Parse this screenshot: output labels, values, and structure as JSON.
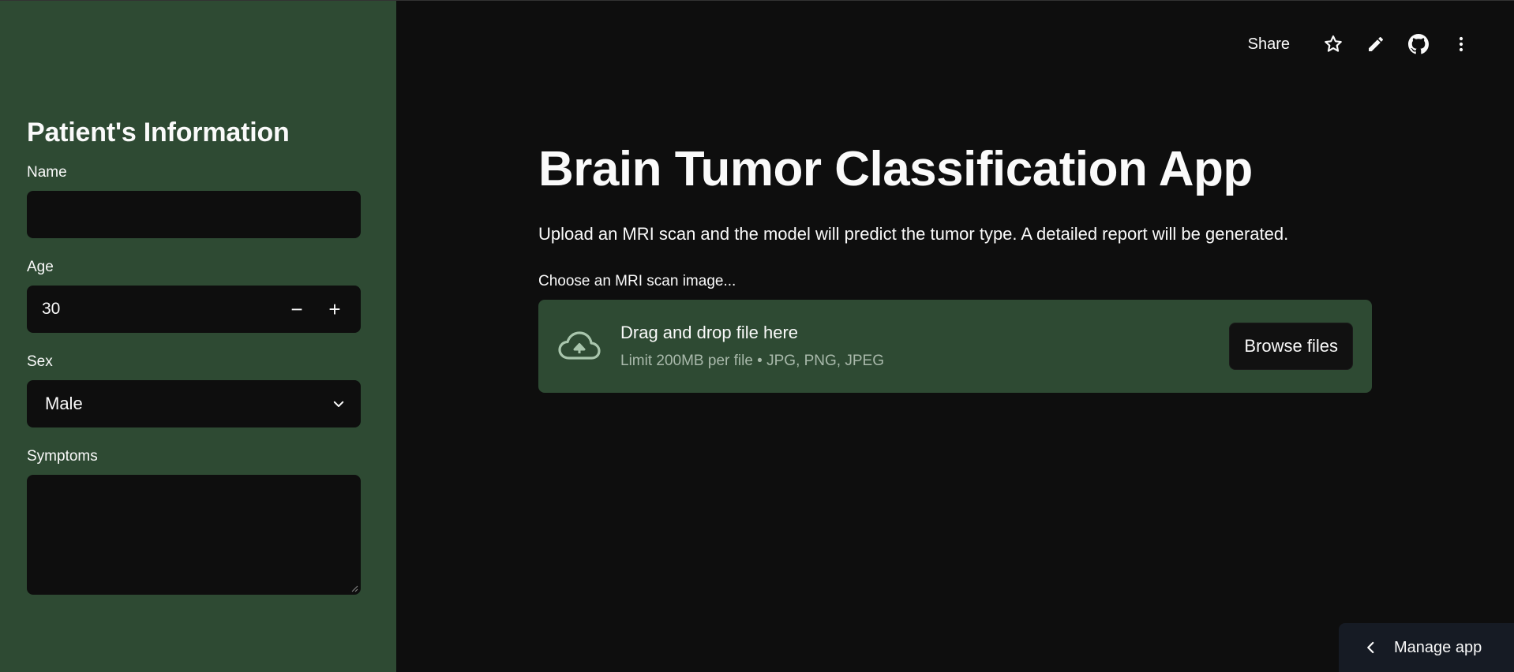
{
  "sidebar": {
    "title": "Patient's Information",
    "name_label": "Name",
    "name_value": "",
    "age_label": "Age",
    "age_value": "30",
    "age_decrement": "−",
    "age_increment": "+",
    "sex_label": "Sex",
    "sex_value": "Male",
    "symptoms_label": "Symptoms",
    "symptoms_value": ""
  },
  "toolbar": {
    "share_label": "Share",
    "icons": [
      "star-icon",
      "pencil-icon",
      "github-icon",
      "more-vertical-icon"
    ]
  },
  "main": {
    "title": "Brain Tumor Classification App",
    "description": "Upload an MRI scan and the model will predict the tumor type. A detailed report will be generated.",
    "uploader_label": "Choose an MRI scan image...",
    "dropzone_title": "Drag and drop file here",
    "dropzone_limit": "Limit 200MB per file • JPG, PNG, JPEG",
    "browse_label": "Browse files"
  },
  "footer": {
    "manage_label": "Manage app"
  },
  "colors": {
    "sidebar_bg": "#2e4a33",
    "main_bg": "#0e0e0e",
    "input_bg": "#0e0e0e",
    "dropzone_bg": "#2e4a33",
    "upload_icon": "#a9c6ad"
  }
}
